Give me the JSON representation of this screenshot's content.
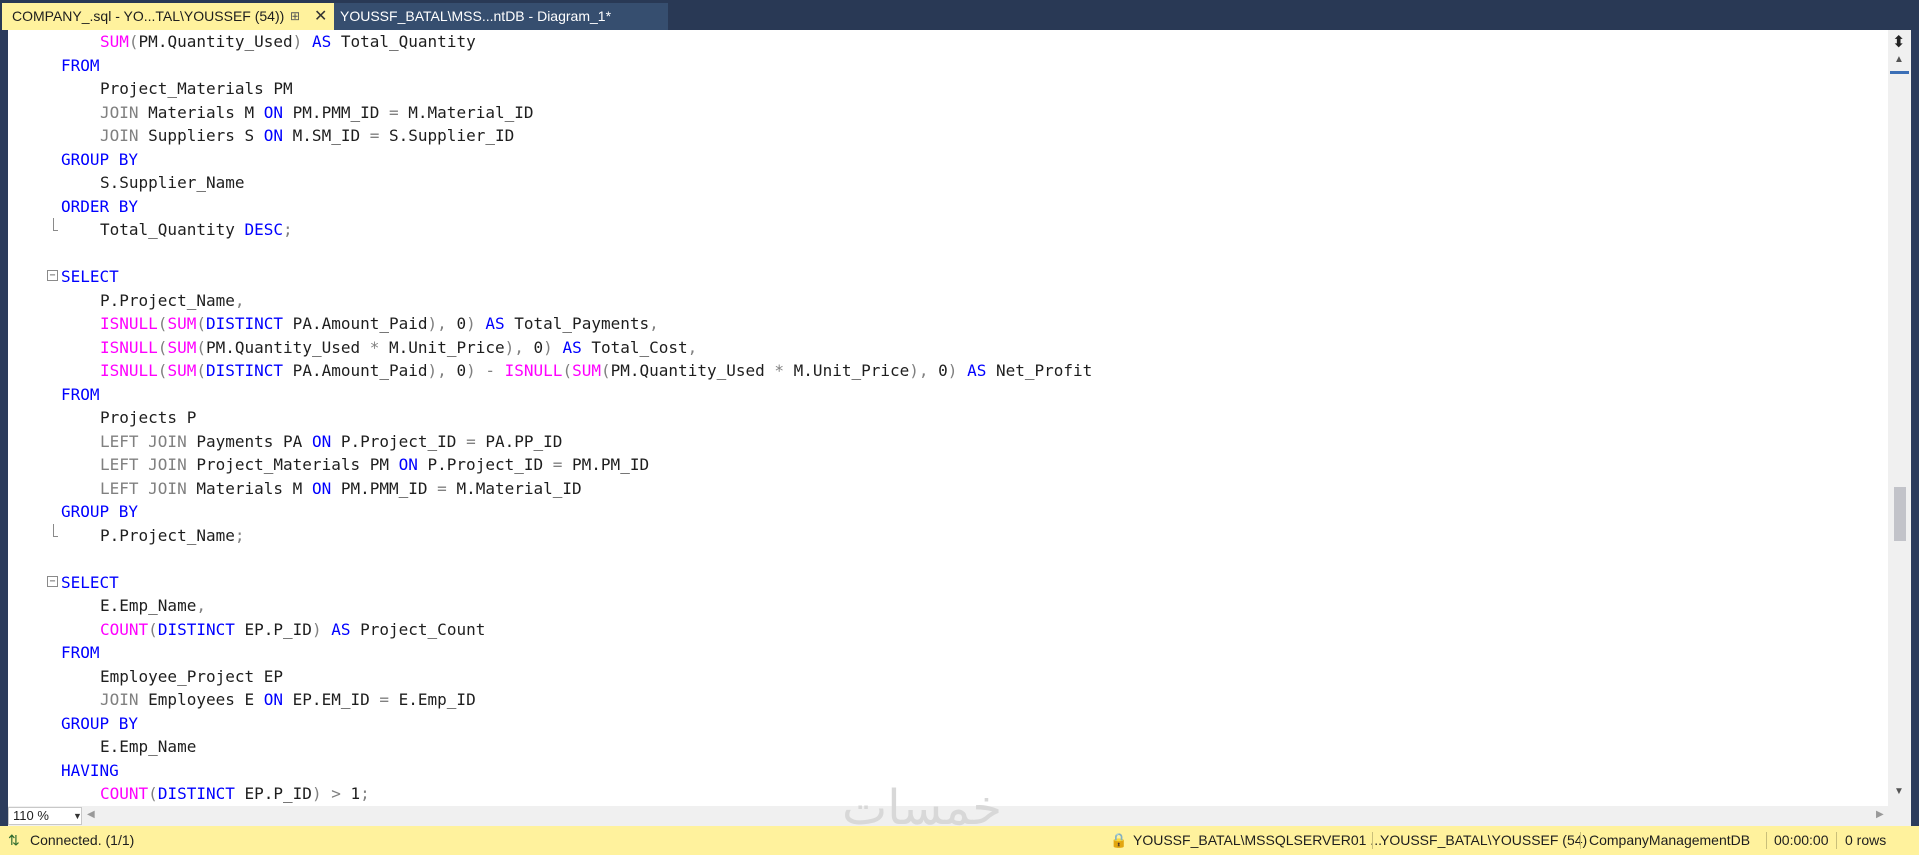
{
  "tabs": [
    {
      "label": "COMPANY_.sql - YO...TAL\\YOUSSEF (54))",
      "active": true
    },
    {
      "label": "YOUSSF_BATAL\\MSS...ntDB - Diagram_1*",
      "active": false
    }
  ],
  "tab_icons": {
    "pin": "pin-icon",
    "close": "close-icon"
  },
  "code_lines": [
    {
      "indent": 1,
      "tokens": [
        [
          "fn",
          "SUM"
        ],
        [
          "gr",
          "("
        ],
        [
          "",
          "PM.Quantity_Used"
        ],
        [
          "gr",
          ")"
        ],
        [
          "",
          " "
        ],
        [
          "kw",
          "AS"
        ],
        [
          "",
          " Total_Quantity"
        ]
      ]
    },
    {
      "indent": 0,
      "tokens": [
        [
          "kw",
          "FROM"
        ]
      ]
    },
    {
      "indent": 1,
      "tokens": [
        [
          "",
          "Project_Materials PM"
        ]
      ]
    },
    {
      "indent": 1,
      "tokens": [
        [
          "gr",
          "JOIN"
        ],
        [
          "",
          " Materials M "
        ],
        [
          "kw",
          "ON"
        ],
        [
          "",
          " PM.PMM_ID "
        ],
        [
          "gr",
          "="
        ],
        [
          "",
          " M.Material_ID"
        ]
      ]
    },
    {
      "indent": 1,
      "tokens": [
        [
          "gr",
          "JOIN"
        ],
        [
          "",
          " Suppliers S "
        ],
        [
          "kw",
          "ON"
        ],
        [
          "",
          " M.SM_ID "
        ],
        [
          "gr",
          "="
        ],
        [
          "",
          " S.Supplier_ID"
        ]
      ]
    },
    {
      "indent": 0,
      "tokens": [
        [
          "kw",
          "GROUP BY"
        ]
      ]
    },
    {
      "indent": 1,
      "tokens": [
        [
          "",
          "S.Supplier_Name"
        ]
      ]
    },
    {
      "indent": 0,
      "tokens": [
        [
          "kw",
          "ORDER BY"
        ]
      ]
    },
    {
      "indent": 1,
      "tokens": [
        [
          "",
          "Total_Quantity "
        ],
        [
          "kw",
          "DESC"
        ],
        [
          "gr",
          ";"
        ]
      ],
      "fold_end": true
    },
    {
      "indent": 0,
      "tokens": []
    },
    {
      "indent": 0,
      "tokens": [
        [
          "kw",
          "SELECT"
        ]
      ],
      "fold_start": true
    },
    {
      "indent": 1,
      "tokens": [
        [
          "",
          "P.Project_Name"
        ],
        [
          "gr",
          ","
        ]
      ]
    },
    {
      "indent": 1,
      "tokens": [
        [
          "fn",
          "ISNULL"
        ],
        [
          "gr",
          "("
        ],
        [
          "fn",
          "SUM"
        ],
        [
          "gr",
          "("
        ],
        [
          "kw",
          "DISTINCT"
        ],
        [
          "",
          " PA.Amount_Paid"
        ],
        [
          "gr",
          "),"
        ],
        [
          "",
          " 0"
        ],
        [
          "gr",
          ")"
        ],
        [
          "",
          " "
        ],
        [
          "kw",
          "AS"
        ],
        [
          "",
          " Total_Payments"
        ],
        [
          "gr",
          ","
        ]
      ]
    },
    {
      "indent": 1,
      "tokens": [
        [
          "fn",
          "ISNULL"
        ],
        [
          "gr",
          "("
        ],
        [
          "fn",
          "SUM"
        ],
        [
          "gr",
          "("
        ],
        [
          "",
          "PM.Quantity_Used "
        ],
        [
          "gr",
          "*"
        ],
        [
          "",
          " M.Unit_Price"
        ],
        [
          "gr",
          "),"
        ],
        [
          "",
          " 0"
        ],
        [
          "gr",
          ")"
        ],
        [
          "",
          " "
        ],
        [
          "kw",
          "AS"
        ],
        [
          "",
          " Total_Cost"
        ],
        [
          "gr",
          ","
        ]
      ]
    },
    {
      "indent": 1,
      "tokens": [
        [
          "fn",
          "ISNULL"
        ],
        [
          "gr",
          "("
        ],
        [
          "fn",
          "SUM"
        ],
        [
          "gr",
          "("
        ],
        [
          "kw",
          "DISTINCT"
        ],
        [
          "",
          " PA.Amount_Paid"
        ],
        [
          "gr",
          "),"
        ],
        [
          "",
          " 0"
        ],
        [
          "gr",
          ")"
        ],
        [
          "",
          " "
        ],
        [
          "gr",
          "-"
        ],
        [
          "",
          " "
        ],
        [
          "fn",
          "ISNULL"
        ],
        [
          "gr",
          "("
        ],
        [
          "fn",
          "SUM"
        ],
        [
          "gr",
          "("
        ],
        [
          "",
          "PM.Quantity_Used "
        ],
        [
          "gr",
          "*"
        ],
        [
          "",
          " M.Unit_Price"
        ],
        [
          "gr",
          "),"
        ],
        [
          "",
          " 0"
        ],
        [
          "gr",
          ")"
        ],
        [
          "",
          " "
        ],
        [
          "kw",
          "AS"
        ],
        [
          "",
          " Net_Profit"
        ]
      ]
    },
    {
      "indent": 0,
      "tokens": [
        [
          "kw",
          "FROM"
        ]
      ]
    },
    {
      "indent": 1,
      "tokens": [
        [
          "",
          "Projects P"
        ]
      ]
    },
    {
      "indent": 1,
      "tokens": [
        [
          "gr",
          "LEFT JOIN"
        ],
        [
          "",
          " Payments PA "
        ],
        [
          "kw",
          "ON"
        ],
        [
          "",
          " P.Project_ID "
        ],
        [
          "gr",
          "="
        ],
        [
          "",
          " PA.PP_ID"
        ]
      ]
    },
    {
      "indent": 1,
      "tokens": [
        [
          "gr",
          "LEFT JOIN"
        ],
        [
          "",
          " Project_Materials PM "
        ],
        [
          "kw",
          "ON"
        ],
        [
          "",
          " P.Project_ID "
        ],
        [
          "gr",
          "="
        ],
        [
          "",
          " PM.PM_ID"
        ]
      ]
    },
    {
      "indent": 1,
      "tokens": [
        [
          "gr",
          "LEFT JOIN"
        ],
        [
          "",
          " Materials M "
        ],
        [
          "kw",
          "ON"
        ],
        [
          "",
          " PM.PMM_ID "
        ],
        [
          "gr",
          "="
        ],
        [
          "",
          " M.Material_ID"
        ]
      ]
    },
    {
      "indent": 0,
      "tokens": [
        [
          "kw",
          "GROUP BY"
        ]
      ]
    },
    {
      "indent": 1,
      "tokens": [
        [
          "",
          "P.Project_Name"
        ],
        [
          "gr",
          ";"
        ]
      ],
      "fold_end": true
    },
    {
      "indent": 0,
      "tokens": []
    },
    {
      "indent": 0,
      "tokens": [
        [
          "kw",
          "SELECT"
        ]
      ],
      "fold_start": true
    },
    {
      "indent": 1,
      "tokens": [
        [
          "",
          "E.Emp_Name"
        ],
        [
          "gr",
          ","
        ]
      ]
    },
    {
      "indent": 1,
      "tokens": [
        [
          "fn",
          "COUNT"
        ],
        [
          "gr",
          "("
        ],
        [
          "kw",
          "DISTINCT"
        ],
        [
          "",
          " EP.P_ID"
        ],
        [
          "gr",
          ")"
        ],
        [
          "",
          " "
        ],
        [
          "kw",
          "AS"
        ],
        [
          "",
          " Project_Count"
        ]
      ]
    },
    {
      "indent": 0,
      "tokens": [
        [
          "kw",
          "FROM"
        ]
      ]
    },
    {
      "indent": 1,
      "tokens": [
        [
          "",
          "Employee_Project EP"
        ]
      ]
    },
    {
      "indent": 1,
      "tokens": [
        [
          "gr",
          "JOIN"
        ],
        [
          "",
          " Employees E "
        ],
        [
          "kw",
          "ON"
        ],
        [
          "",
          " EP.EM_ID "
        ],
        [
          "gr",
          "="
        ],
        [
          "",
          " E.Emp_ID"
        ]
      ]
    },
    {
      "indent": 0,
      "tokens": [
        [
          "kw",
          "GROUP BY"
        ]
      ]
    },
    {
      "indent": 1,
      "tokens": [
        [
          "",
          "E.Emp_Name"
        ]
      ]
    },
    {
      "indent": 0,
      "tokens": [
        [
          "kw",
          "HAVING"
        ]
      ]
    },
    {
      "indent": 1,
      "tokens": [
        [
          "fn",
          "COUNT"
        ],
        [
          "gr",
          "("
        ],
        [
          "kw",
          "DISTINCT"
        ],
        [
          "",
          " EP.P_ID"
        ],
        [
          "gr",
          ")"
        ],
        [
          "",
          " "
        ],
        [
          "gr",
          ">"
        ],
        [
          "",
          " 1"
        ],
        [
          "gr",
          ";"
        ]
      ]
    }
  ],
  "zoom": {
    "value": "110 %"
  },
  "status": {
    "connection": "Connected. (1/1)",
    "server": "YOUSSF_BATAL\\MSSQLSERVER01 ...",
    "user": "YOUSSF_BATAL\\YOUSSEF (54)",
    "database": "CompanyManagementDB",
    "elapsed": "00:00:00",
    "rows": "0 rows"
  },
  "watermark": "خمسات",
  "colors": {
    "keyword": "#0000ff",
    "function": "#ff00ff",
    "operator": "#808080",
    "identifier": "#1e1e1e",
    "tab_active": "#fff29d",
    "status_bar": "#fff29d",
    "chrome": "#293955"
  }
}
